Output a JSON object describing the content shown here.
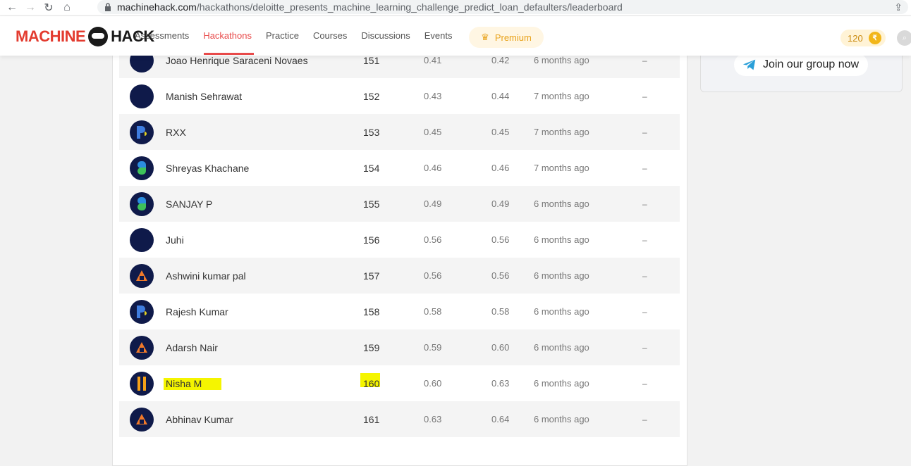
{
  "browser": {
    "back_icon": "←",
    "forward_icon": "→",
    "reload_icon": "↻",
    "home_icon": "⌂",
    "url_host": "machinehack.com",
    "url_path": "/hackathons/deloitte_presents_machine_learning_challenge_predict_loan_defaulters/leaderboard",
    "share_icon": "⇪"
  },
  "header": {
    "logo_left": "MACHINE",
    "logo_right": "HACK",
    "nav": [
      "Assessments",
      "Hackathons",
      "Practice",
      "Courses",
      "Discussions",
      "Events"
    ],
    "active_nav": "Hackathons",
    "premium_label": "Premium",
    "coins": "120",
    "coin_symbol": "₹"
  },
  "side": {
    "join_label": "Join our group now"
  },
  "leaderboard": {
    "rows": [
      {
        "name": "Joao Henrique Saraceni Novaes",
        "rank": "151",
        "score1": "0.41",
        "score2": "0.42",
        "time": "6 months ago",
        "extra": "–",
        "avatar": "blank"
      },
      {
        "name": "Manish Sehrawat",
        "rank": "152",
        "score1": "0.43",
        "score2": "0.44",
        "time": "7 months ago",
        "extra": "–",
        "avatar": "blank"
      },
      {
        "name": "RXX",
        "rank": "153",
        "score1": "0.45",
        "score2": "0.45",
        "time": "7 months ago",
        "extra": "–",
        "avatar": "p"
      },
      {
        "name": "Shreyas Khachane",
        "rank": "154",
        "score1": "0.46",
        "score2": "0.46",
        "time": "7 months ago",
        "extra": "–",
        "avatar": "s"
      },
      {
        "name": "SANJAY P",
        "rank": "155",
        "score1": "0.49",
        "score2": "0.49",
        "time": "6 months ago",
        "extra": "–",
        "avatar": "s"
      },
      {
        "name": "Juhi",
        "rank": "156",
        "score1": "0.56",
        "score2": "0.56",
        "time": "6 months ago",
        "extra": "–",
        "avatar": "blank"
      },
      {
        "name": "Ashwini kumar pal",
        "rank": "157",
        "score1": "0.56",
        "score2": "0.56",
        "time": "6 months ago",
        "extra": "–",
        "avatar": "a"
      },
      {
        "name": "Rajesh Kumar",
        "rank": "158",
        "score1": "0.58",
        "score2": "0.58",
        "time": "6 months ago",
        "extra": "–",
        "avatar": "p"
      },
      {
        "name": "Adarsh Nair",
        "rank": "159",
        "score1": "0.59",
        "score2": "0.60",
        "time": "6 months ago",
        "extra": "–",
        "avatar": "a"
      },
      {
        "name": "Nisha M",
        "rank": "160",
        "score1": "0.60",
        "score2": "0.63",
        "time": "6 months ago",
        "extra": "–",
        "avatar": "b",
        "highlighted": true
      },
      {
        "name": "Abhinav Kumar",
        "rank": "161",
        "score1": "0.63",
        "score2": "0.64",
        "time": "6 months ago",
        "extra": "–",
        "avatar": "a"
      }
    ]
  }
}
